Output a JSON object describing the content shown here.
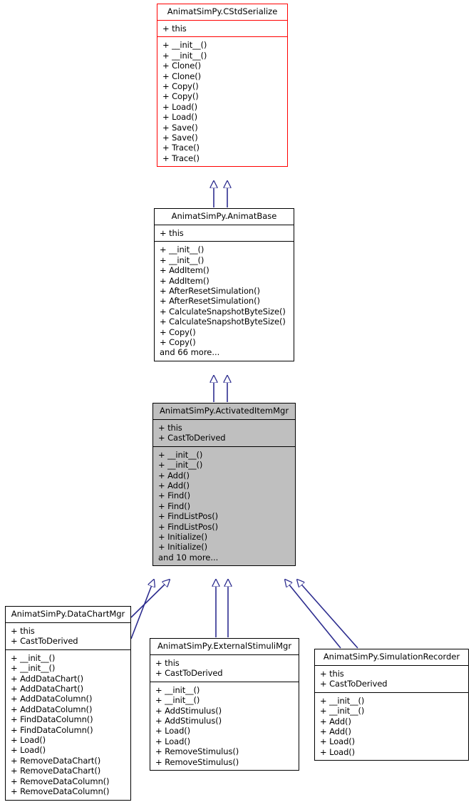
{
  "diagram": {
    "type": "uml-class-inheritance",
    "title": "AnimatSimPy.ActivatedItemMgr inheritance diagram",
    "edge_color": "#2d2d8f",
    "highlight_fill": "#bfbfbf",
    "root_border_color": "#ff0000",
    "default_border_color": "#000000",
    "relationship": "generalization"
  },
  "nodes": {
    "cstdserialize": {
      "name": "AnimatSimPy.CStdSerialize",
      "attributes": [
        "+ this"
      ],
      "methods": [
        "+ __init__()",
        "+ __init__()",
        "+ Clone()",
        "+ Clone()",
        "+ Copy()",
        "+ Copy()",
        "+ Load()",
        "+ Load()",
        "+ Save()",
        "+ Save()",
        "+ Trace()",
        "+ Trace()"
      ],
      "more": ""
    },
    "animatbase": {
      "name": "AnimatSimPy.AnimatBase",
      "attributes": [
        "+ this"
      ],
      "methods": [
        "+ __init__()",
        "+ __init__()",
        "+ AddItem()",
        "+ AddItem()",
        "+ AfterResetSimulation()",
        "+ AfterResetSimulation()",
        "+ CalculateSnapshotByteSize()",
        "+ CalculateSnapshotByteSize()",
        "+ Copy()",
        "+ Copy()"
      ],
      "more": "and 66 more..."
    },
    "activateditemmgr": {
      "name": "AnimatSimPy.ActivatedItemMgr",
      "attributes": [
        "+ this",
        "+ CastToDerived"
      ],
      "methods": [
        "+ __init__()",
        "+ __init__()",
        "+ Add()",
        "+ Add()",
        "+ Find()",
        "+ Find()",
        "+ FindListPos()",
        "+ FindListPos()",
        "+ Initialize()",
        "+ Initialize()"
      ],
      "more": "and 10 more..."
    },
    "datachartmgr": {
      "name": "AnimatSimPy.DataChartMgr",
      "attributes": [
        "+ this",
        "+ CastToDerived"
      ],
      "methods": [
        "+ __init__()",
        "+ __init__()",
        "+ AddDataChart()",
        "+ AddDataChart()",
        "+ AddDataColumn()",
        "+ AddDataColumn()",
        "+ FindDataColumn()",
        "+ FindDataColumn()",
        "+ Load()",
        "+ Load()",
        "+ RemoveDataChart()",
        "+ RemoveDataChart()",
        "+ RemoveDataColumn()",
        "+ RemoveDataColumn()"
      ],
      "more": ""
    },
    "externalstimulimgr": {
      "name": "AnimatSimPy.ExternalStimuliMgr",
      "attributes": [
        "+ this",
        "+ CastToDerived"
      ],
      "methods": [
        "+ __init__()",
        "+ __init__()",
        "+ AddStimulus()",
        "+ AddStimulus()",
        "+ Load()",
        "+ Load()",
        "+ RemoveStimulus()",
        "+ RemoveStimulus()"
      ],
      "more": ""
    },
    "simulationrecorder": {
      "name": "AnimatSimPy.SimulationRecorder",
      "attributes": [
        "+ this",
        "+ CastToDerived"
      ],
      "methods": [
        "+ __init__()",
        "+ __init__()",
        "+ Add()",
        "+ Add()",
        "+ Load()",
        "+ Load()"
      ],
      "more": ""
    }
  }
}
